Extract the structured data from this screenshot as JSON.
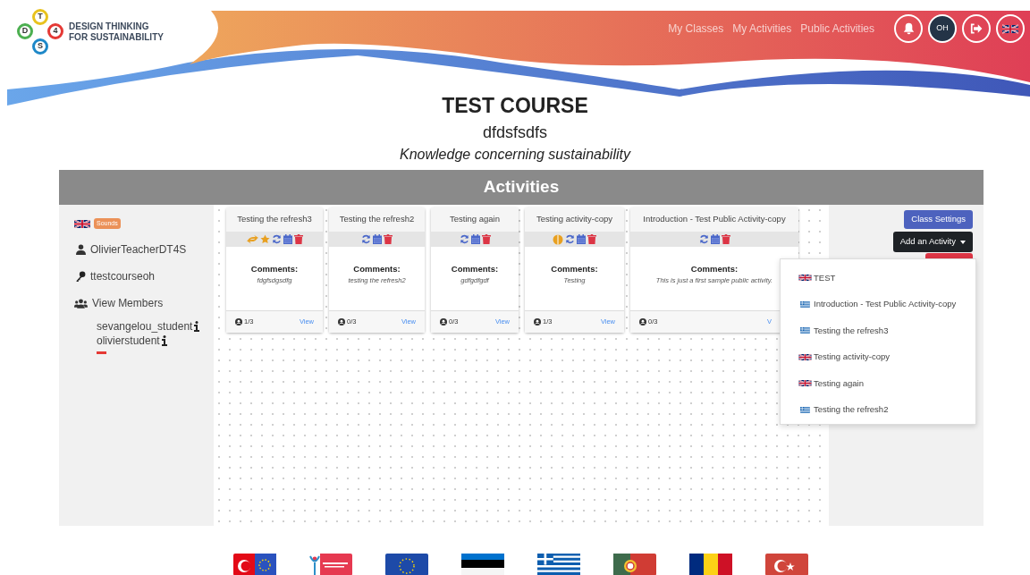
{
  "header": {
    "logo_letters": [
      "T",
      "D",
      "4",
      "S"
    ],
    "logo_text": [
      "DESIGN THINKING",
      "FOR SUSTAINABILITY"
    ],
    "nav": [
      {
        "label": "My Classes"
      },
      {
        "label": "My Activities"
      },
      {
        "label": "Public Activities"
      }
    ],
    "avatar_initials": "OH",
    "language_flag": {
      "kind": "uk"
    }
  },
  "course": {
    "title": "TEST COURSE",
    "code": "dfdsfsdfs",
    "subtitle": "Knowledge concerning sustainability"
  },
  "section_title": "Activities",
  "sidebar": {
    "flag": {
      "kind": "uk"
    },
    "sounds_badge": "Sounds",
    "teacher": "OlivierTeacherDT4S",
    "course_key": "ttestcourseoh",
    "view_members": "View Members",
    "members": [
      {
        "name": "sevangelou_student",
        "underlined": false
      },
      {
        "name": "olivierstudent",
        "underlined": true
      }
    ]
  },
  "activities": [
    {
      "title": "Testing the refresh3",
      "icons": [
        {
          "kind": "swap"
        },
        {
          "kind": "star"
        },
        {
          "kind": "refresh"
        },
        {
          "kind": "calendar"
        },
        {
          "kind": "trash"
        }
      ],
      "comments_label": "Comments:",
      "comment": "fdgfsdgsdfg",
      "members": "1/3",
      "view": "View"
    },
    {
      "title": "Testing the refresh2",
      "icons": [
        {
          "kind": "refresh"
        },
        {
          "kind": "calendar"
        },
        {
          "kind": "trash"
        }
      ],
      "comments_label": "Comments:",
      "comment": "testing the refresh2",
      "members": "0/3",
      "view": "View"
    },
    {
      "title": "Testing again",
      "icons": [
        {
          "kind": "refresh"
        },
        {
          "kind": "calendar"
        },
        {
          "kind": "trash"
        }
      ],
      "comments_label": "Comments:",
      "comment": "gdfgdfgdf",
      "members": "0/3",
      "view": "View"
    },
    {
      "title": "Testing activity-copy",
      "icons": [
        {
          "kind": "brain"
        },
        {
          "kind": "refresh"
        },
        {
          "kind": "calendar"
        },
        {
          "kind": "trash"
        }
      ],
      "comments_label": "Comments:",
      "comment": "Testing",
      "members": "1/3",
      "view": "View"
    },
    {
      "title": "Introduction - Test Public Activity-copy",
      "icons": [
        {
          "kind": "refresh"
        },
        {
          "kind": "calendar"
        },
        {
          "kind": "trash"
        }
      ],
      "comments_label": "Comments:",
      "comment": "This is just a first sample public activity.",
      "members": "0/3",
      "view": "V"
    }
  ],
  "right_panel": {
    "class_settings": "Class Settings",
    "add_activity": "Add an Activity",
    "dropdown": [
      {
        "kind": "uk",
        "label": "TEST"
      },
      {
        "kind": "gr",
        "label": "Introduction - Test Public Activity-copy"
      },
      {
        "kind": "gr",
        "label": "Testing the refresh3"
      },
      {
        "kind": "uk",
        "label": "Testing activity-copy"
      },
      {
        "kind": "uk",
        "label": "Testing again"
      },
      {
        "kind": "gr",
        "label": "Testing the refresh2"
      }
    ]
  },
  "partner_logos": [
    {
      "kind": "turkey-eu"
    },
    {
      "kind": "agency"
    },
    {
      "kind": "eu"
    },
    {
      "kind": "estonia"
    },
    {
      "kind": "greece"
    },
    {
      "kind": "portugal"
    },
    {
      "kind": "romania"
    },
    {
      "kind": "turkey"
    }
  ]
}
